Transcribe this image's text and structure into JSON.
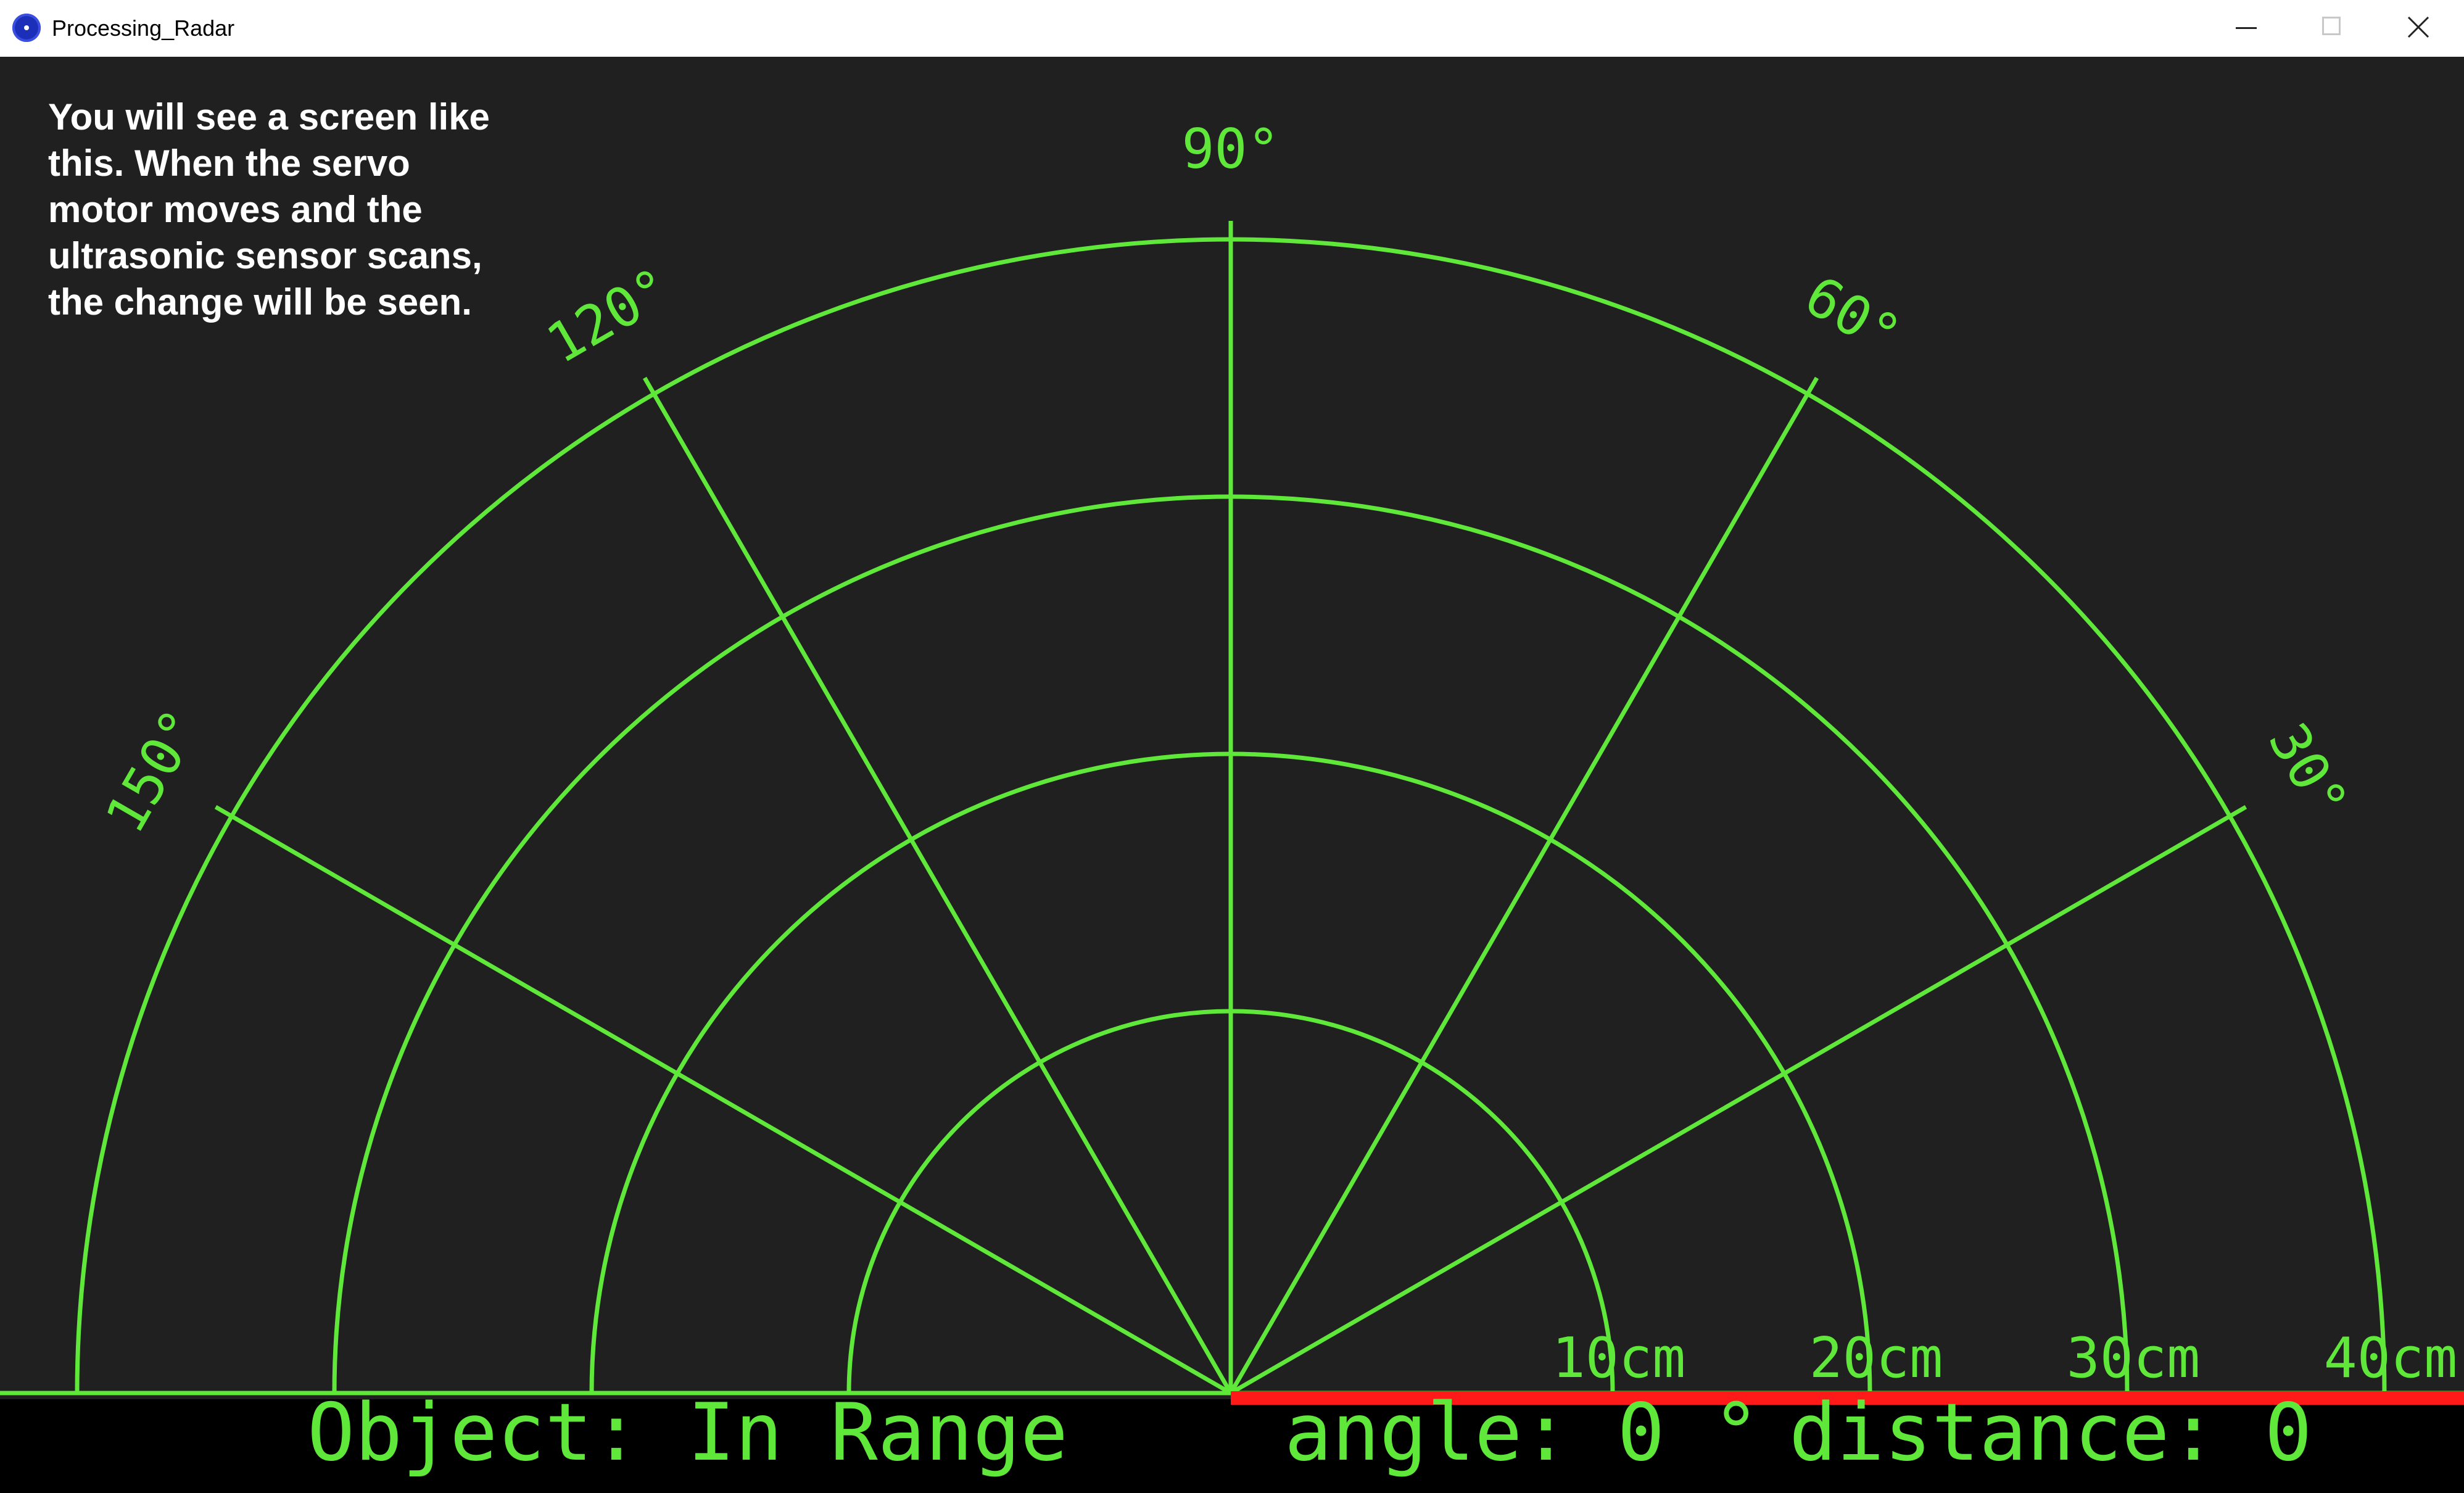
{
  "window": {
    "title": "Processing_Radar",
    "controls": [
      "minimize",
      "maximize",
      "close"
    ]
  },
  "note": "You will see a screen like this. When the servo motor moves and the ultrasonic sensor scans, the change will be seen.",
  "radar": {
    "line_color": "#5fe83a",
    "sweep_color": "#ff1a1a",
    "angle_labels": [
      "150°",
      "120°",
      "90°",
      "60°",
      "30°"
    ],
    "range_labels": [
      "10cm",
      "20cm",
      "30cm",
      "40cm"
    ],
    "sweep_angle_deg": 0
  },
  "status": {
    "object_text": "Object: In Range",
    "angle_text": "angle: 0 °",
    "distance_text": "distance: 0"
  }
}
